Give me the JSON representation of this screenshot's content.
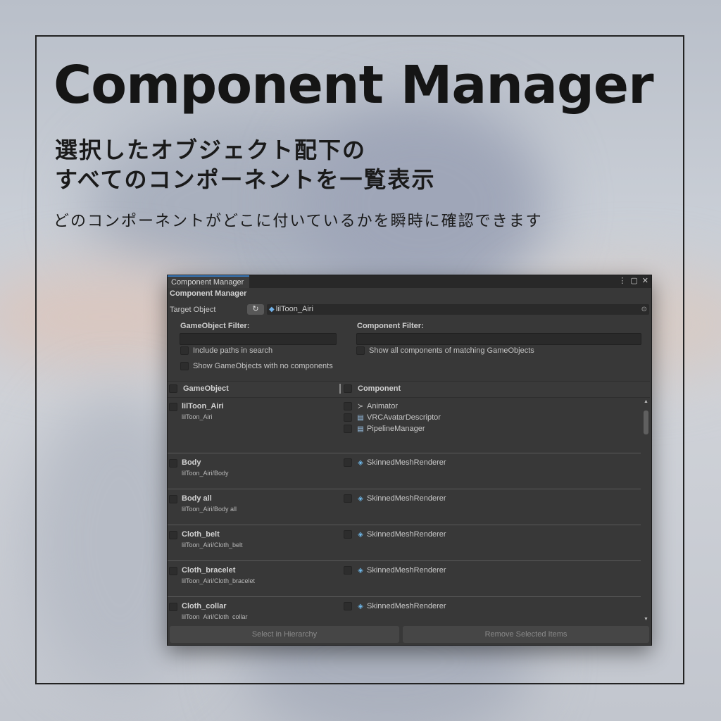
{
  "promo": {
    "headline": "Component Manager",
    "subtitle_line1": "選択したオブジェクト配下の",
    "subtitle_line2": "すべてのコンポーネントを一覧表示",
    "caption": "どのコンポーネントがどこに付いているかを瞬時に確認できます"
  },
  "window": {
    "tab_label": "Component Manager",
    "title": "Component Manager",
    "controls": {
      "menu": "⋮",
      "maximize": "▢",
      "close": "✕"
    },
    "target": {
      "label": "Target Object",
      "refresh_icon": "↻",
      "value": "lilToon_Airi",
      "picker_icon": "⊙"
    },
    "gameobject_filter": {
      "label": "GameObject Filter:",
      "value": ""
    },
    "component_filter": {
      "label": "Component Filter:",
      "value": ""
    },
    "options": {
      "include_paths": "Include paths in search",
      "show_empty": "Show GameObjects with no components",
      "show_all_components": "Show all components of matching GameObjects"
    },
    "columns": {
      "gameobject": "GameObject",
      "component": "Component"
    },
    "rows": [
      {
        "name": "lilToon_Airi",
        "path": "lilToon_Airi",
        "components": [
          {
            "icon": "animator-icon",
            "glyph": "≻",
            "label": "Animator"
          },
          {
            "icon": "script-icon",
            "glyph": "▤",
            "label": "VRCAvatarDescriptor"
          },
          {
            "icon": "script-icon",
            "glyph": "▤",
            "label": "PipelineManager"
          }
        ]
      },
      {
        "name": "Body",
        "path": "lilToon_Airi/Body",
        "components": [
          {
            "icon": "skinned-mesh-icon",
            "glyph": "◈",
            "label": "SkinnedMeshRenderer"
          }
        ]
      },
      {
        "name": "Body all",
        "path": "lilToon_Airi/Body all",
        "components": [
          {
            "icon": "skinned-mesh-icon",
            "glyph": "◈",
            "label": "SkinnedMeshRenderer"
          }
        ]
      },
      {
        "name": "Cloth_belt",
        "path": "lilToon_Airi/Cloth_belt",
        "components": [
          {
            "icon": "skinned-mesh-icon",
            "glyph": "◈",
            "label": "SkinnedMeshRenderer"
          }
        ]
      },
      {
        "name": "Cloth_bracelet",
        "path": "lilToon_Airi/Cloth_bracelet",
        "components": [
          {
            "icon": "skinned-mesh-icon",
            "glyph": "◈",
            "label": "SkinnedMeshRenderer"
          }
        ]
      },
      {
        "name": "Cloth_collar",
        "path": "lilToon_Airi/Cloth_collar",
        "components": [
          {
            "icon": "skinned-mesh-icon",
            "glyph": "◈",
            "label": "SkinnedMeshRenderer"
          }
        ]
      }
    ],
    "scroll": {
      "up": "▲",
      "down": "▼"
    },
    "buttons": {
      "select_hierarchy": "Select in Hierarchy",
      "remove_selected": "Remove Selected Items"
    }
  },
  "colors": {
    "window_bg": "#383838",
    "tab_accent": "#3a79bb",
    "text": "#c8c8c8",
    "icon_blue": "#6fb8ea"
  }
}
